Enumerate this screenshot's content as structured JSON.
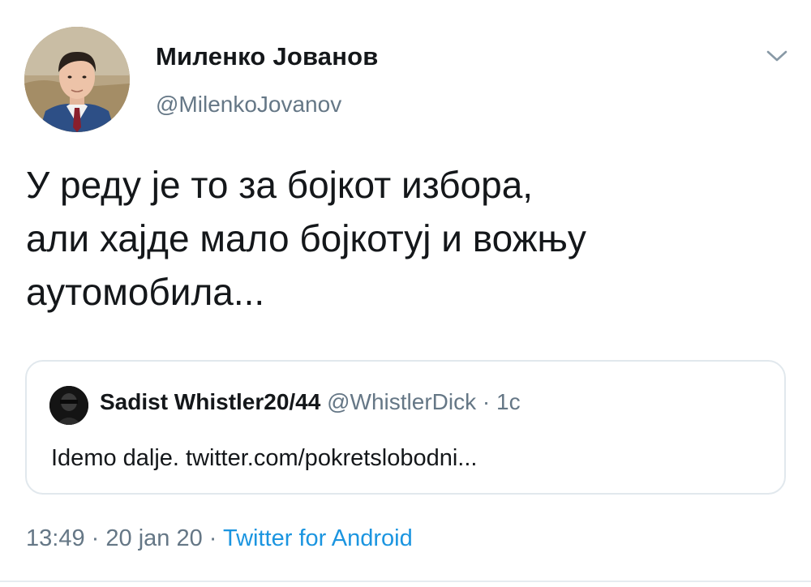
{
  "author": {
    "display_name": "Миленко Јованов",
    "handle": "@MilenkoJovanov",
    "avatar_icon": "profile-photo"
  },
  "tweet": {
    "text": "У реду је то за бојкот избора,\nали хајде мало бојкотуј и вожњу\nаутомобила..."
  },
  "quoted_tweet": {
    "display_name": "Sadist Whistler20/44",
    "handle": "@WhistlerDick",
    "separator": "·",
    "time": "1c",
    "text": "Idemo dalje. twitter.com/pokretslobodni..."
  },
  "meta": {
    "time": "13:49",
    "separator": "·",
    "date": "20 jan 20",
    "separator2": "·",
    "source": "Twitter for Android"
  },
  "colors": {
    "text_primary": "#14171a",
    "text_secondary": "#657786",
    "link": "#1b95e0",
    "border": "#e1e8ed"
  }
}
